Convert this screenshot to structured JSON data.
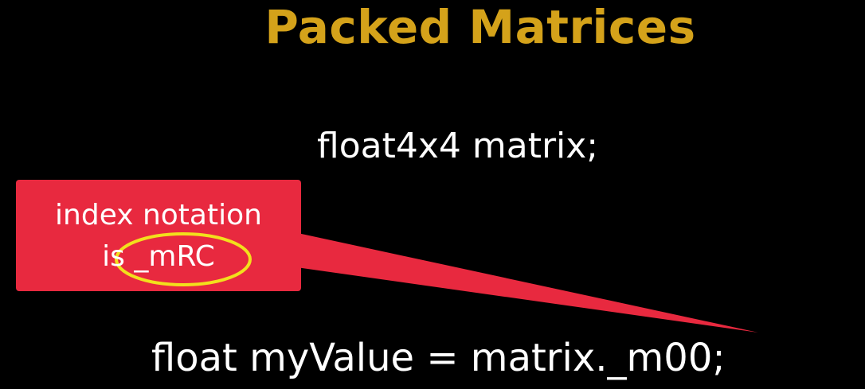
{
  "slide": {
    "title": "Packed Matrices",
    "code_line_1": "float4x4 matrix;",
    "code_line_2": "float myValue = matrix._m00;",
    "callout": {
      "line_1": "index notation",
      "line_2": "is _mRC"
    }
  },
  "colors": {
    "background": "#000000",
    "title": "#d4a21a",
    "text": "#ffffff",
    "callout_fill": "#e8293f",
    "highlight_circle": "#f2e01c"
  }
}
